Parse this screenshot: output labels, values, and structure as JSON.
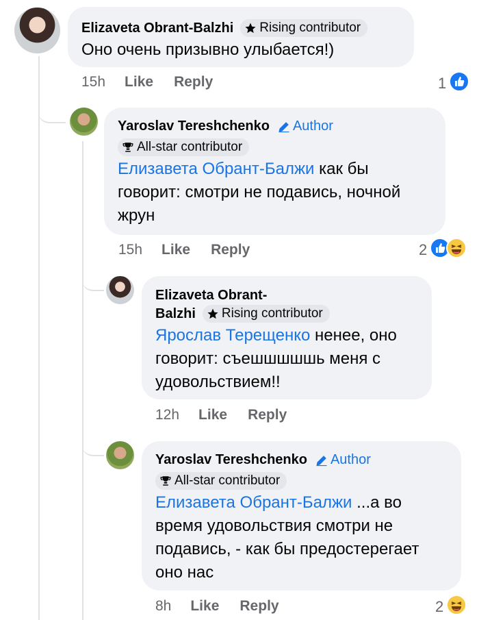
{
  "comments": [
    {
      "author": "Elizaveta Obrant-Balzhi",
      "badge": "Rising contributor",
      "text": "Оно очень призывно улыбается!)",
      "time": "15h",
      "like": "Like",
      "reply": "Reply",
      "reaction_count": "1",
      "reactions": [
        "like"
      ]
    },
    {
      "author": "Yaroslav Tereshchenko",
      "author_tag": "Author",
      "badge": "All-star contributor",
      "mention": "Елизавета Обрант-Балжи",
      "text_line1": " как бы",
      "text_line2": "говорит: смотри не подавись, ночной",
      "text_line3": "жрун",
      "time": "15h",
      "like": "Like",
      "reply": "Reply",
      "reaction_count": "2",
      "reactions": [
        "like",
        "haha"
      ]
    },
    {
      "author_line1": "Elizaveta Obrant-",
      "author_line2": "Balzhi",
      "badge": "Rising contributor",
      "mention": "Ярослав Терещенко",
      "text_line1": " ненее, оно",
      "text_line2": "говорит: съешшшшшь меня с",
      "text_line3": "удовольствием!!",
      "time": "12h",
      "like": "Like",
      "reply": "Reply"
    },
    {
      "author": "Yaroslav Tereshchenko",
      "author_tag": "Author",
      "badge": "All-star contributor",
      "mention": "Елизавета Обрант-Балжи",
      "text_line1": " ...а во",
      "text_line2": "время удовольствия смотри не",
      "text_line3": "подавись, - как бы предостерегает",
      "text_line4": "оно нас",
      "time": "8h",
      "like": "Like",
      "reply": "Reply",
      "reaction_count": "2",
      "reactions": [
        "haha"
      ]
    }
  ],
  "colors": {
    "bubble": "#f0f2f5",
    "link": "#1b74e4",
    "meta": "#65676b",
    "like_blue": "#1877f2",
    "haha_yellow": "#f7c843"
  },
  "icons": [
    "star-icon",
    "pencil-icon",
    "trophy-icon",
    "like-reaction-icon",
    "haha-reaction-icon"
  ]
}
